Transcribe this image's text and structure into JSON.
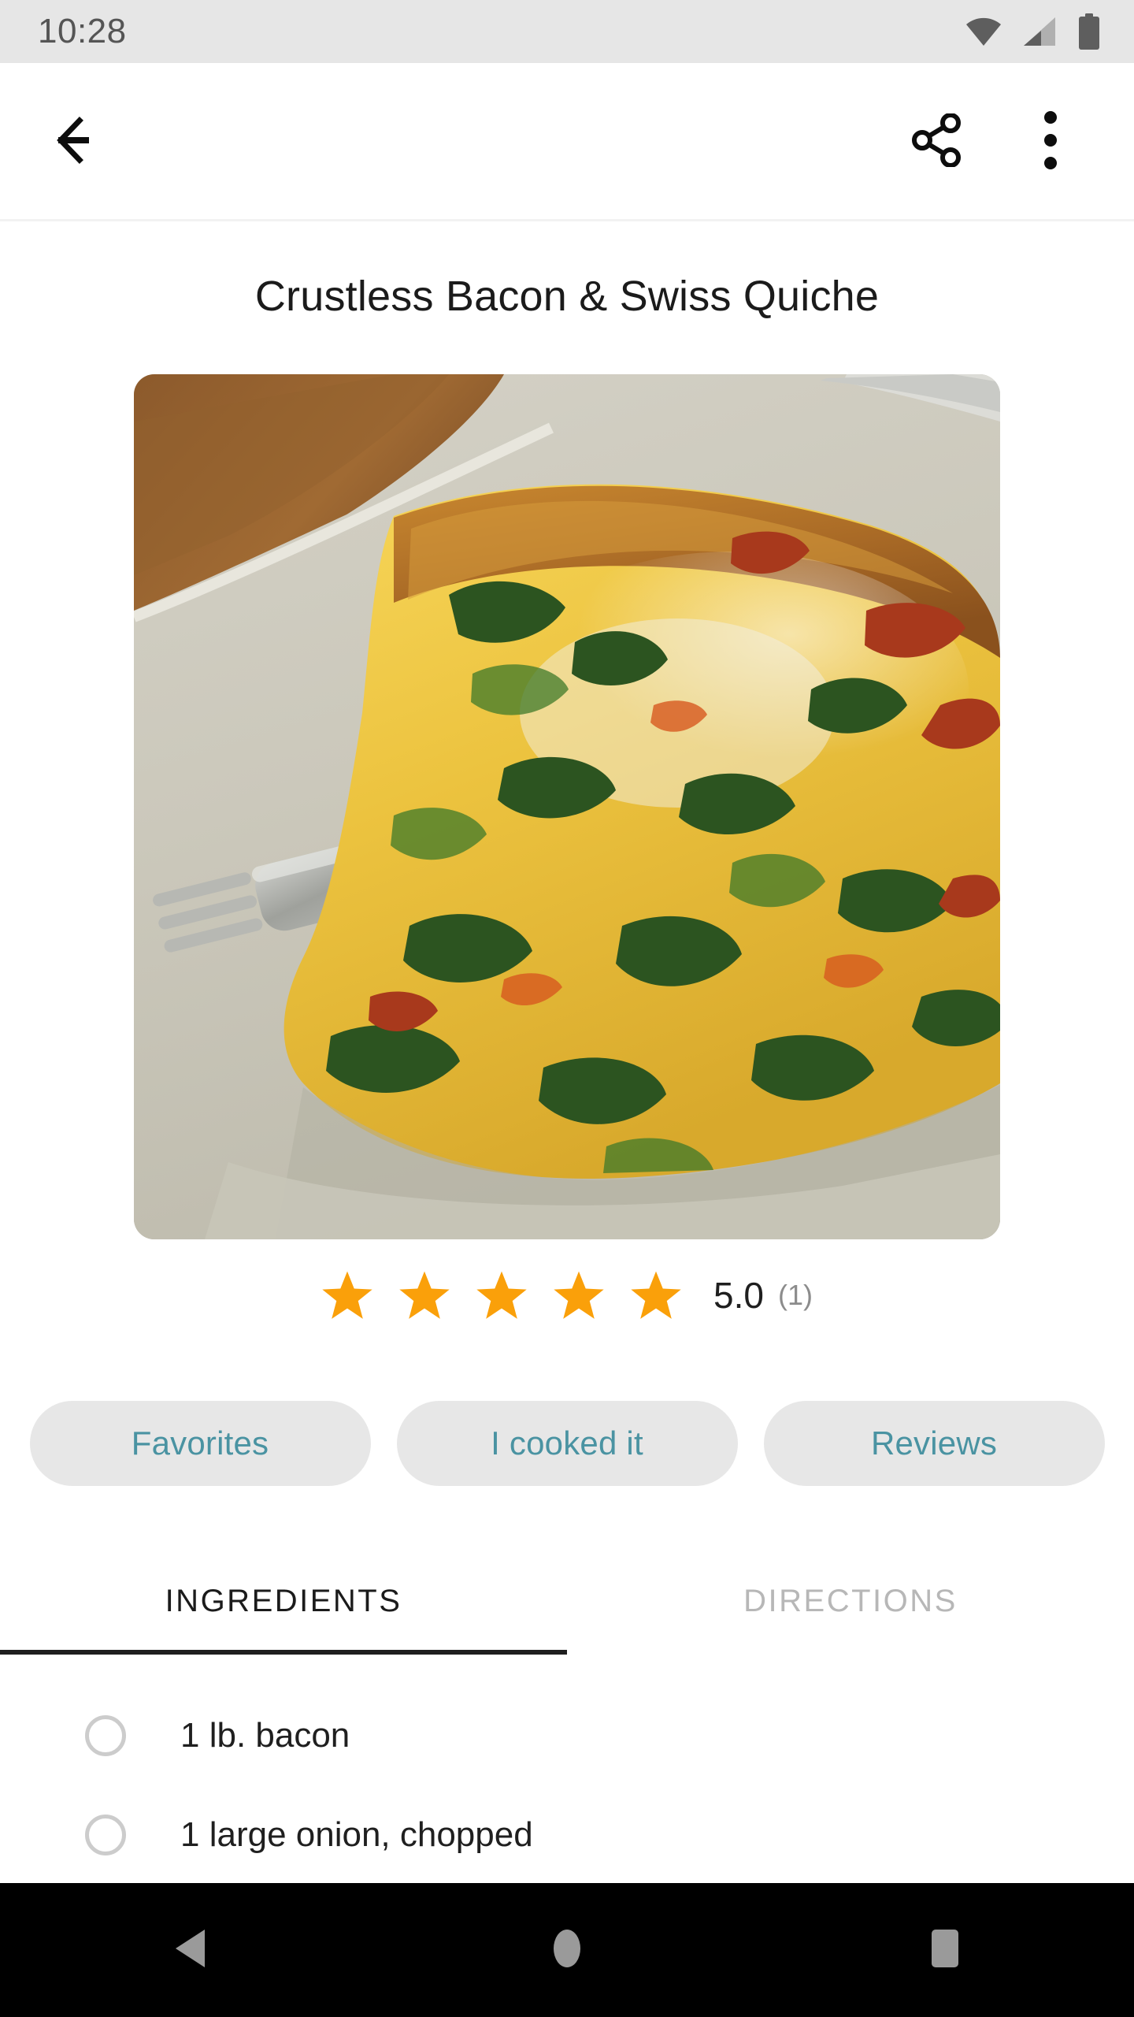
{
  "status_bar": {
    "time": "10:28",
    "icons": [
      "wifi-icon",
      "cellular-signal-icon",
      "battery-icon"
    ]
  },
  "app_bar": {
    "back_icon": "back-arrow-icon",
    "share_icon": "share-icon",
    "overflow_icon": "overflow-menu-icon"
  },
  "recipe": {
    "title": "Crustless Bacon & Swiss Quiche",
    "photo_alt": "slice-of-quiche-on-plate-with-fork"
  },
  "rating": {
    "stars_filled": 5,
    "stars_total": 5,
    "value": "5.0",
    "count": "(1)",
    "star_color": "#FAA00A"
  },
  "actions": [
    {
      "label": "Favorites",
      "name": "favorites-button"
    },
    {
      "label": "I cooked it",
      "name": "i-cooked-it-button"
    },
    {
      "label": "Reviews",
      "name": "reviews-button"
    }
  ],
  "tabs": [
    {
      "label": "INGREDIENTS",
      "active": true
    },
    {
      "label": "DIRECTIONS",
      "active": false
    }
  ],
  "ingredients": [
    {
      "text": "1 lb. bacon",
      "checked": false
    },
    {
      "text": "1 large onion, chopped",
      "checked": false
    }
  ],
  "nav_bar": {
    "back": "nav-back-icon",
    "home": "nav-home-icon",
    "recents": "nav-recents-icon"
  },
  "colors": {
    "accent_teal": "#4A93A2",
    "star_orange": "#FAA00A",
    "pill_bg": "#E7E7E7",
    "status_bg": "#E6E6E6",
    "tab_active": "#1B1B1B",
    "tab_inactive": "#B7B7B7"
  }
}
